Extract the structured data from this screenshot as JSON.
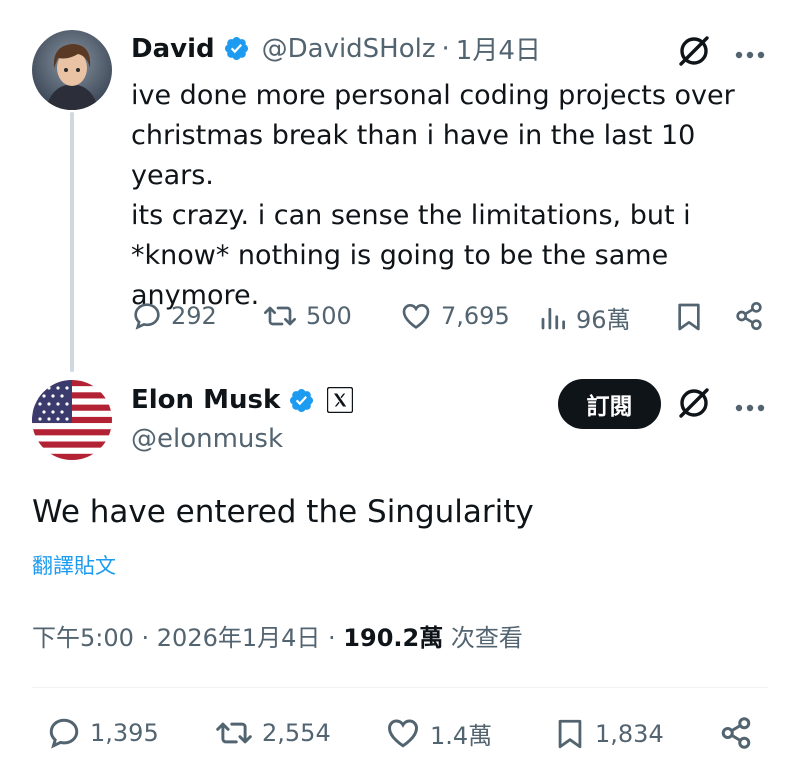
{
  "quoted_tweet": {
    "author_name": "David",
    "author_handle": "@DavidSHolz",
    "separator": "·",
    "date": "1月4日",
    "text_lines": [
      "ive done more personal coding projects over",
      "christmas break than i have in the last 10 years.",
      "its crazy. i can sense the limitations, but i",
      "*know* nothing is going to be the same",
      "anymore."
    ],
    "stats": {
      "replies": "292",
      "reposts": "500",
      "likes": "7,695",
      "views": "96萬"
    }
  },
  "main_tweet": {
    "author_name": "Elon Musk",
    "author_handle": "@elonmusk",
    "subscribe_label": "訂閱",
    "text": "We have entered the Singularity",
    "translate_label": "翻譯貼文",
    "timestamp": "下午5:00 · 2026年1月4日 · ",
    "views_count": "190.2萬",
    "views_label": " 次查看",
    "stats": {
      "replies": "1,395",
      "reposts": "2,554",
      "likes": "1.4萬",
      "bookmarks": "1,834"
    }
  },
  "colors": {
    "text_primary": "#0f1419",
    "text_secondary": "#536471",
    "link": "#1d9bf0",
    "verified": "#1d9bf0",
    "thread_line": "#cfd9de",
    "button_bg": "#0f1419"
  },
  "icons": [
    "verified-badge-icon",
    "grok-icon",
    "more-icon",
    "reply-icon",
    "repost-icon",
    "like-icon",
    "views-icon",
    "bookmark-icon",
    "share-icon",
    "x-logo-icon"
  ]
}
